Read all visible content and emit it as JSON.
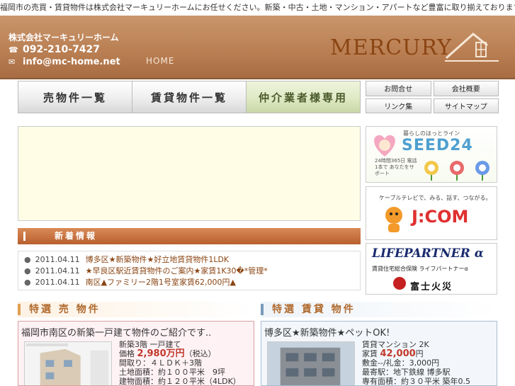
{
  "topbar": {
    "text": "福岡市の売買・賃貸物件は株式会社マーキュリーホームにお任せください。新築・中古・土地・マンション・アパートなど豊富に取り揃えております"
  },
  "header": {
    "company": "株式会社マーキュリーホーム",
    "phone": "092-210-7427",
    "email": "info@mc-home.net",
    "home": "HOME",
    "logo_text": "MERCURY"
  },
  "nav": {
    "tabs": [
      {
        "label": "売物件一覧"
      },
      {
        "label": "賃貸物件一覧"
      },
      {
        "label": "仲介業者様専用"
      }
    ]
  },
  "subnav": {
    "items": [
      {
        "label": "お問合せ"
      },
      {
        "label": "会社概要"
      },
      {
        "label": "リンク集"
      },
      {
        "label": "サイトマップ"
      }
    ]
  },
  "news": {
    "title": "新着情報",
    "items": [
      {
        "date": "2011.04.11",
        "text": "博多区★新築物件★好立地賃貸物件1LDK"
      },
      {
        "date": "2011.04.11",
        "text": "★早良区駅近賃貸物件のご案内★家賃1K30�*管理*"
      },
      {
        "date": "2011.04.11",
        "text": "南区▲ファミリー2階1号室家賃62,000円▲"
      }
    ]
  },
  "side": {
    "seed24": {
      "small": "暮らしのほっとライン",
      "big": "SEED24",
      "sub": "24時間365日 電話1本で あなたをサポート"
    },
    "jcom": {
      "small": "ケーブルテレビで、みる、話す、つながる。",
      "big": "J:COM"
    },
    "lifepartner": {
      "big": "LIFEPARTNER α",
      "mid": "賃貸住宅総合保険 ライフパートナーα",
      "fuji": "富士火災"
    }
  },
  "featured": {
    "sale": {
      "header": "特選 売 物件",
      "title": "福岡市南区の新築一戸建て物件のご紹介です..",
      "line1": "新築3階 一戸建て",
      "price": "2,980万円",
      "price_suffix": "（税込）",
      "line3": "間取り：４ＬＤＫ＋3階",
      "line4": "土地面積：約１００平米　9坪",
      "line5": "建物面積：約１２０平米（4LDK）"
    },
    "rent": {
      "header": "特選 賃貸 物件",
      "title": "博多区★新築物件★ペットOK!",
      "line1": "賃貸マンション 2K",
      "price": "42,000",
      "price_suffix": "円",
      "line3": "敷金--/礼金：3,000円",
      "line4": "最寄駅：地下鉄線 博多駅",
      "line5": "専有面積：約３０平米 築年0.5"
    }
  }
}
